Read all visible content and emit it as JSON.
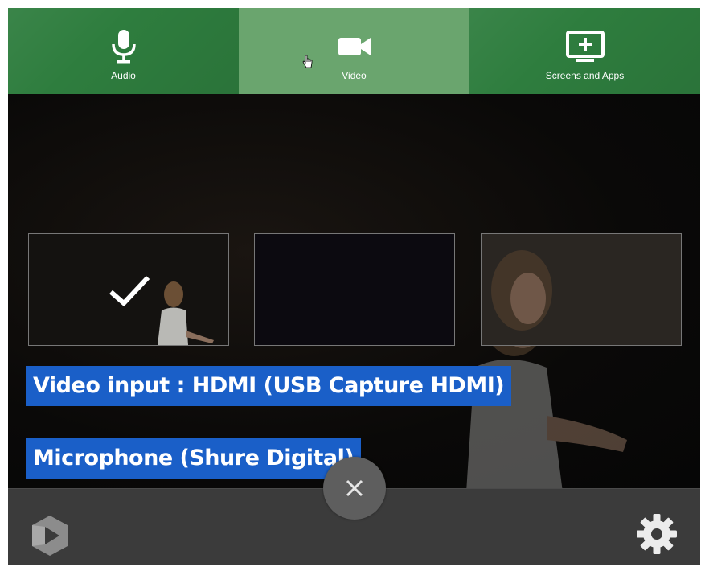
{
  "tabs": [
    {
      "label": "Audio",
      "icon": "microphone-icon"
    },
    {
      "label": "Video",
      "icon": "video-camera-icon",
      "active": true
    },
    {
      "label": "Screens and Apps",
      "icon": "screen-add-icon"
    }
  ],
  "captions": {
    "video_input": "Video input : HDMI (USB Capture HDMI)",
    "microphone": "Microphone (Shure Digital)"
  },
  "thumbnails": [
    {
      "selected": true
    },
    {
      "selected": false
    },
    {
      "selected": false
    }
  ],
  "colors": {
    "tab_green": "#2e7d3e",
    "tab_active": "#6aa56e",
    "caption_blue": "#1a5fc8",
    "bottom_bar": "#3b3b3b"
  }
}
